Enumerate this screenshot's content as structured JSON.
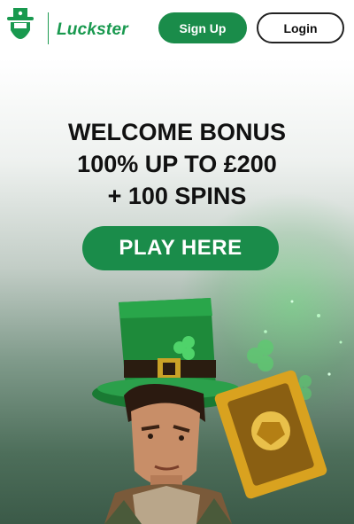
{
  "header": {
    "logo_text": "Luckster",
    "signup_label": "Sign Up",
    "login_label": "Login"
  },
  "hero": {
    "headline": [
      "WELCOME BONUS",
      "100% UP TO £200",
      "+ 100 SPINS"
    ],
    "cta_label": "PLAY HERE"
  },
  "colors": {
    "brand_green": "#1a8c4a",
    "logo_green": "#19994f",
    "text_dark": "#111111"
  },
  "icons": [
    "leprechaun-logo-icon",
    "leprechaun-character-illustration",
    "clover-icon",
    "golden-card-icon"
  ]
}
